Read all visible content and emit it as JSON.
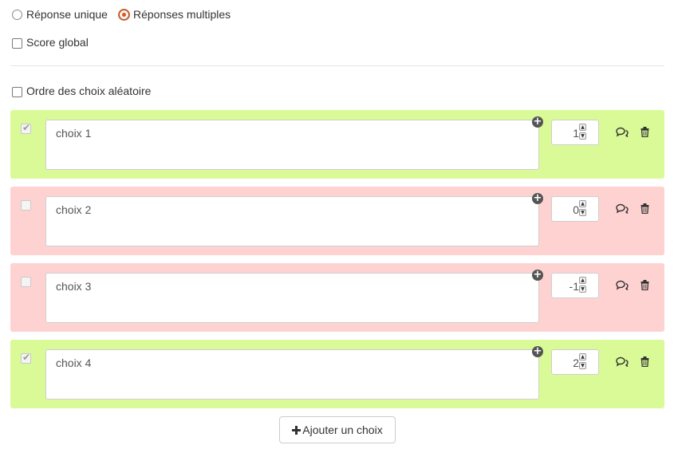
{
  "mode": {
    "single_label": "Réponse unique",
    "multiple_label": "Réponses multiples",
    "selected": "multiple"
  },
  "options": {
    "global_score_label": "Score global",
    "random_order_label": "Ordre des choix aléatoire"
  },
  "choices": [
    {
      "text": "choix 1",
      "score": "1",
      "correct": true
    },
    {
      "text": "choix 2",
      "score": "0",
      "correct": false
    },
    {
      "text": "choix 3",
      "score": "-1",
      "correct": false
    },
    {
      "text": "choix 4",
      "score": "2",
      "correct": true
    }
  ],
  "add_button": {
    "icon": "plus-icon",
    "label": "Ajouter un choix"
  },
  "icons": {
    "feedback": "comment-icon",
    "delete": "trash-icon",
    "add_text": "plus-circle-icon"
  },
  "colors": {
    "correct_row": "#d9fa96",
    "wrong_row": "#ffd2d2",
    "radio_accent": "#e0541a"
  }
}
